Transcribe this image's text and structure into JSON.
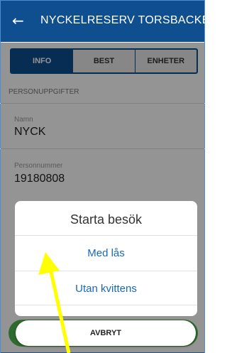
{
  "appbar": {
    "back_icon": "arrow-left-icon",
    "back_glyph": "←",
    "title": "NYCKELRESERV TORSBACKE"
  },
  "tabs": [
    {
      "label": "INFO",
      "active": true
    },
    {
      "label": "BEST",
      "active": false
    },
    {
      "label": "ENHETER",
      "active": false
    }
  ],
  "section": {
    "title": "PERSONUPPGIFTER"
  },
  "fields": [
    {
      "label": "Namn",
      "value": "NYCK"
    },
    {
      "label": "Personnummer",
      "value": "19180808"
    }
  ],
  "dialog": {
    "title": "Starta besök",
    "options": [
      "Med lås",
      "Utan kvittens"
    ]
  },
  "cancel_button": {
    "label": "AVBRYT"
  },
  "annotation": {
    "arrow_icon": "yellow-arrow-icon",
    "color": "#ffff00"
  },
  "colors": {
    "primary": "#0f4f8f",
    "link": "#1769b8"
  }
}
